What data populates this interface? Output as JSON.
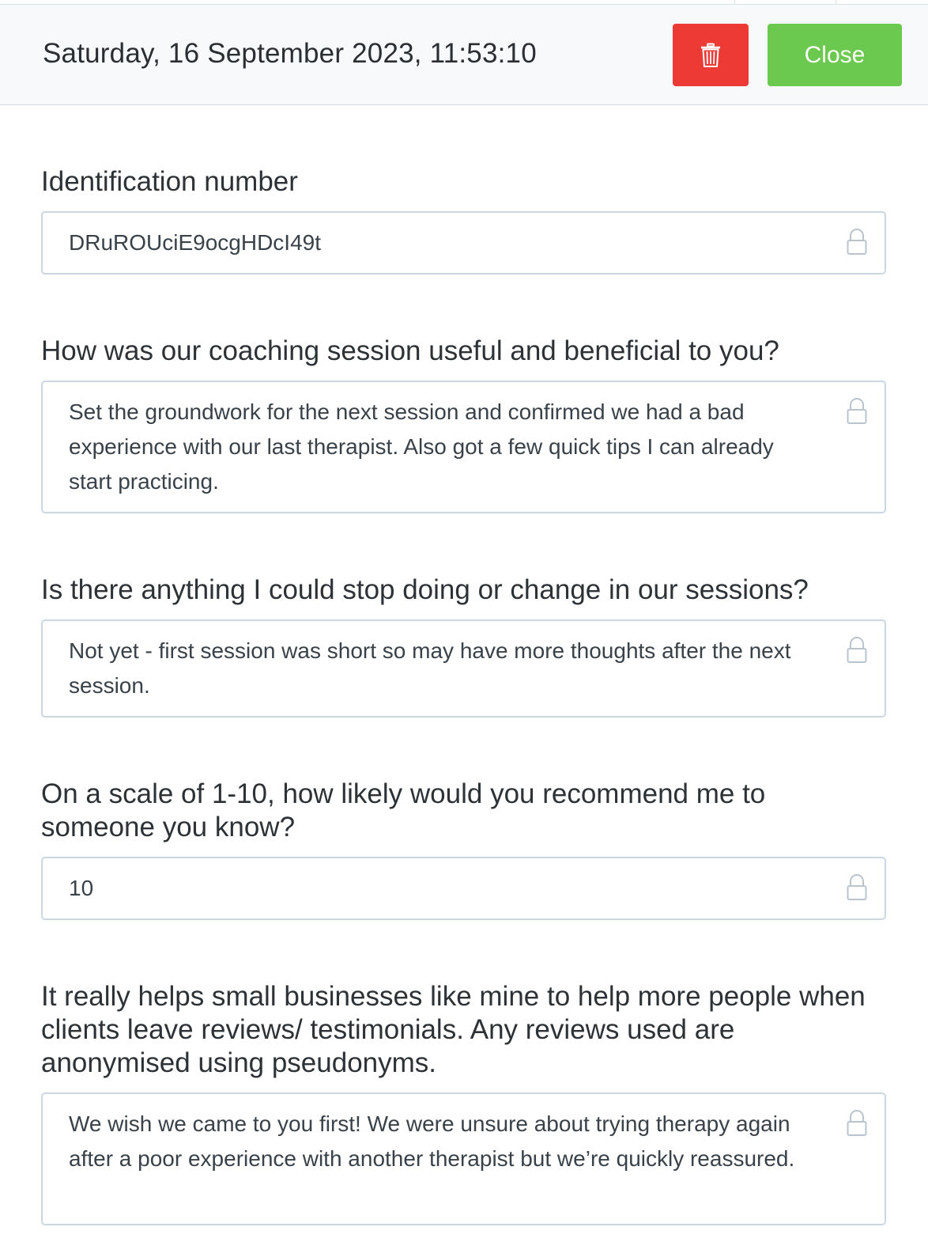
{
  "header": {
    "datetime": "Saturday, 16 September 2023, 11:53:10",
    "delete_icon": "trash-icon",
    "close_label": "Close"
  },
  "colors": {
    "delete": "#ee3a35",
    "close": "#6cc94f",
    "border": "#c9d8e3"
  },
  "fields": [
    {
      "label": "Identification number",
      "value": "DRuROUciE9ocgHDcI49t",
      "icon": "lock-icon"
    },
    {
      "label": "How was our coaching session useful and beneficial to you?",
      "value": "Set the groundwork for the next session and confirmed we had a bad experience with our last therapist. Also got a few quick tips I can already start practicing.",
      "icon": "lock-icon"
    },
    {
      "label": "Is there anything I could stop doing or change in our sessions?",
      "value": "Not yet - first session was short so may have more thoughts after the next session.",
      "icon": "lock-icon"
    },
    {
      "label": "On a scale of 1-10, how likely would you recommend me to someone you know?",
      "value": "10",
      "icon": "lock-icon"
    },
    {
      "label": "It really helps small businesses like mine to help more people when clients leave reviews/ testimonials. Any reviews used are anonymised using pseudonyms.",
      "value": "We wish we came to you first! We were unsure about trying therapy again after a poor experience with another therapist but we’re quickly reassured.",
      "icon": "lock-icon"
    }
  ]
}
